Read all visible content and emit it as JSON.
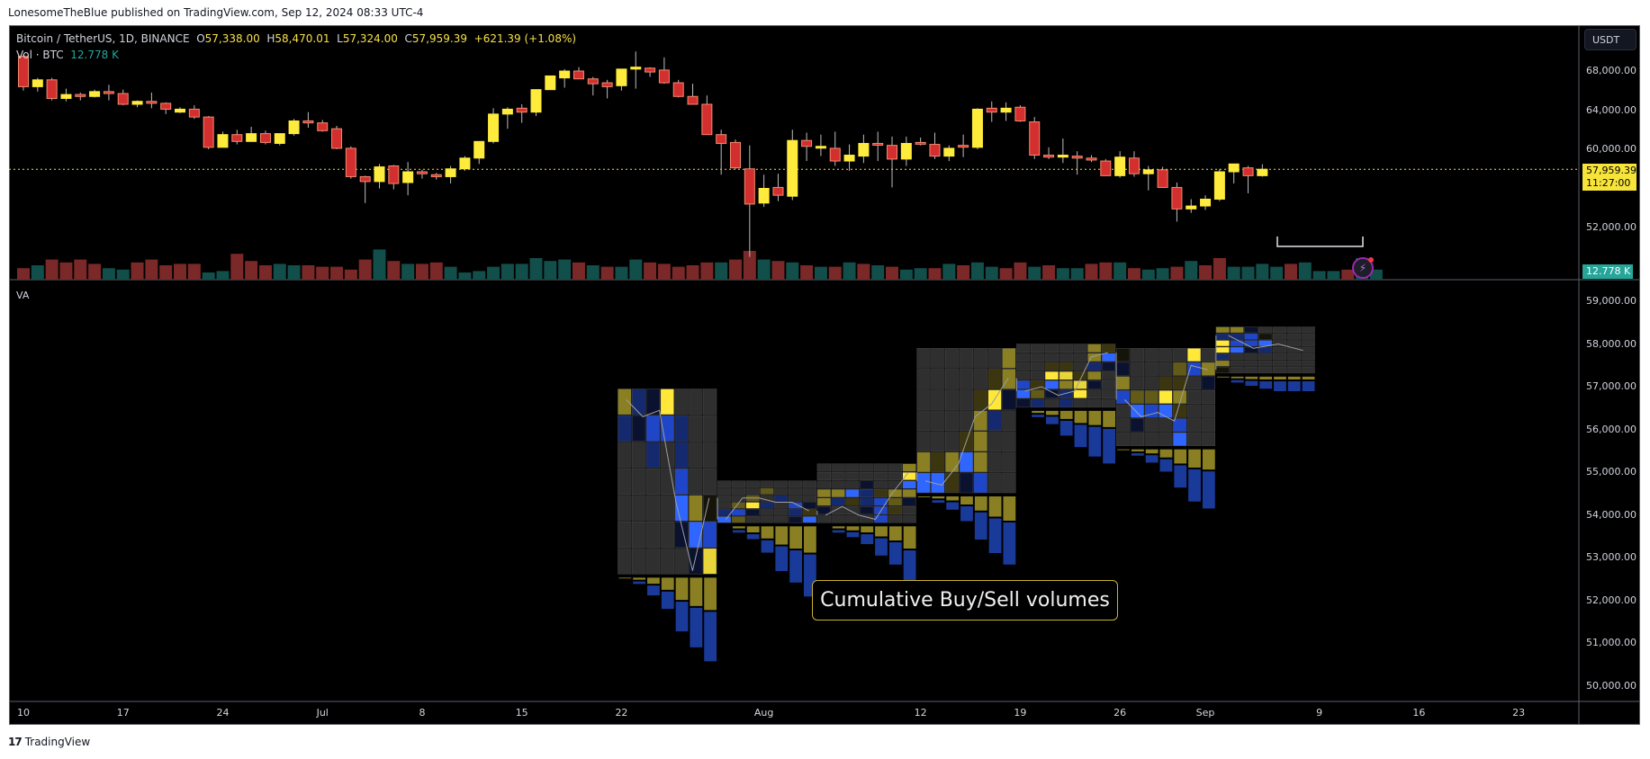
{
  "publisher_line": "LonesomeTheBlue published on TradingView.com, Sep 12, 2024 08:33 UTC-4",
  "legend": {
    "symbol": "Bitcoin / TetherUS, 1D, BINANCE",
    "open_label": "O",
    "open": "57,338.00",
    "high_label": "H",
    "high": "58,470.01",
    "low_label": "L",
    "low": "57,324.00",
    "close_label": "C",
    "close": "57,959.39",
    "change": "+621.39 (+1.08%)",
    "volume_label": "Vol · BTC",
    "volume_value": "12.778 K"
  },
  "pane2_label": "VA",
  "currency_button": "USDT",
  "price_tag": {
    "price": "57,959.39",
    "countdown": "11:27:00"
  },
  "volume_tag": "12.778 K",
  "annotation": "Cumulative Buy/Sell volumes",
  "footer_logo": "TradingView",
  "colors": {
    "up": "#ffeb3b",
    "down": "#d32f2f",
    "vol_up": "#124e4a",
    "vol_down": "#7a2828",
    "buy": "#2962ff",
    "sell": "#c9b22a",
    "last_price": "#f7e43a"
  },
  "chart_data": [
    {
      "type": "candlestick",
      "title": "Bitcoin / TetherUS, 1D, BINANCE",
      "ylabel": "USDT",
      "ylim": [
        48000,
        70500
      ],
      "y_ticks": [
        "68,000.00",
        "64,000.00",
        "60,000.00",
        "52,000.00"
      ],
      "x_ticks": [
        "10",
        "17",
        "24",
        "Jul",
        "8",
        "15",
        "22",
        "Aug",
        "12",
        "19",
        "26",
        "Sep",
        "9",
        "16",
        "23"
      ],
      "x_tick_days": [
        0,
        7,
        14,
        21,
        28,
        35,
        42,
        52,
        63,
        70,
        77,
        83,
        91,
        98,
        105
      ],
      "last_price": 57959.39,
      "candles": [
        [
          69500,
          69700,
          66000,
          66400
        ],
        [
          66400,
          67300,
          65900,
          67100
        ],
        [
          67100,
          67300,
          65000,
          65200
        ],
        [
          65200,
          66200,
          64900,
          65600
        ],
        [
          65600,
          65800,
          65000,
          65400
        ],
        [
          65400,
          66100,
          65300,
          65900
        ],
        [
          65900,
          66600,
          65000,
          65700
        ],
        [
          65700,
          66100,
          64500,
          64600
        ],
        [
          64600,
          65000,
          64300,
          64900
        ],
        [
          64900,
          65800,
          64200,
          64700
        ],
        [
          64700,
          64800,
          63600,
          64100
        ],
        [
          63800,
          64300,
          63700,
          64100
        ],
        [
          64100,
          64500,
          63100,
          63300
        ],
        [
          63300,
          63400,
          60000,
          60200
        ],
        [
          60200,
          61800,
          60200,
          61500
        ],
        [
          61500,
          62000,
          60500,
          60800
        ],
        [
          60800,
          62300,
          60800,
          61600
        ],
        [
          61600,
          61900,
          60500,
          60700
        ],
        [
          60600,
          61300,
          60400,
          61600
        ],
        [
          61600,
          63100,
          61400,
          62900
        ],
        [
          62900,
          63800,
          62200,
          62700
        ],
        [
          62700,
          63000,
          61800,
          61900
        ],
        [
          62100,
          62400,
          60000,
          60100
        ],
        [
          60100,
          60300,
          57000,
          57200
        ],
        [
          57200,
          57300,
          54500,
          56700
        ],
        [
          56700,
          58500,
          56000,
          58200
        ],
        [
          58300,
          58400,
          55900,
          56500
        ],
        [
          56600,
          58700,
          55300,
          57700
        ],
        [
          57700,
          57900,
          57000,
          57500
        ],
        [
          57400,
          57600,
          56900,
          57200
        ],
        [
          57200,
          58300,
          56500,
          58000
        ],
        [
          58000,
          59300,
          57800,
          59100
        ],
        [
          59100,
          60200,
          58500,
          60800
        ],
        [
          60800,
          64200,
          60600,
          63600
        ],
        [
          63600,
          64300,
          62100,
          64100
        ],
        [
          64200,
          64600,
          62700,
          63800
        ],
        [
          63800,
          66100,
          63400,
          66100
        ],
        [
          66100,
          67400,
          66300,
          67500
        ],
        [
          67300,
          68200,
          66300,
          68000
        ],
        [
          68000,
          68400,
          67200,
          67200
        ],
        [
          67200,
          67400,
          65500,
          66700
        ],
        [
          66800,
          67100,
          65200,
          66400
        ],
        [
          66500,
          68200,
          66000,
          68200
        ],
        [
          68200,
          70000,
          66200,
          68400
        ],
        [
          68300,
          68400,
          67400,
          67900
        ],
        [
          68100,
          69400,
          66700,
          66800
        ],
        [
          66800,
          67100,
          65300,
          65400
        ],
        [
          65400,
          66700,
          65000,
          64600
        ],
        [
          64600,
          65500,
          61800,
          61500
        ],
        [
          61500,
          62000,
          57400,
          60600
        ],
        [
          60700,
          61000,
          58000,
          58100
        ],
        [
          58000,
          60400,
          49000,
          54400
        ],
        [
          54500,
          57400,
          54100,
          56000
        ],
        [
          56100,
          57500,
          54700,
          55300
        ],
        [
          55200,
          62000,
          54800,
          60900
        ],
        [
          60900,
          61700,
          58800,
          60300
        ],
        [
          60200,
          61500,
          59300,
          60300
        ],
        [
          60100,
          61800,
          58300,
          58800
        ],
        [
          58800,
          60500,
          57800,
          59400
        ],
        [
          59300,
          61500,
          58600,
          60600
        ],
        [
          60600,
          61800,
          58800,
          60500
        ],
        [
          60400,
          61300,
          56100,
          59000
        ],
        [
          59000,
          61300,
          58300,
          60600
        ],
        [
          60700,
          61200,
          60400,
          60600
        ],
        [
          60500,
          61700,
          59000,
          59300
        ],
        [
          59300,
          60400,
          58800,
          60100
        ],
        [
          60400,
          61500,
          59200,
          60300
        ],
        [
          60200,
          64200,
          60000,
          64100
        ],
        [
          64200,
          64900,
          62800,
          63800
        ],
        [
          63800,
          64800,
          62900,
          64200
        ],
        [
          64300,
          64500,
          62800,
          62900
        ],
        [
          62800,
          63300,
          59000,
          59400
        ],
        [
          59400,
          60200,
          59000,
          59200
        ],
        [
          59200,
          61100,
          58600,
          59400
        ],
        [
          59300,
          59800,
          57400,
          59100
        ],
        [
          59100,
          59400,
          58700,
          58900
        ],
        [
          58800,
          59000,
          57500,
          57300
        ],
        [
          57300,
          59800,
          57100,
          59200
        ],
        [
          59100,
          59800,
          57200,
          57500
        ],
        [
          57500,
          58300,
          55800,
          57900
        ],
        [
          57900,
          58200,
          56300,
          56100
        ],
        [
          56100,
          56600,
          52600,
          53900
        ],
        [
          53900,
          54900,
          53500,
          54200
        ],
        [
          54200,
          55300,
          53800,
          54900
        ],
        [
          54900,
          58000,
          54700,
          57700
        ],
        [
          57700,
          58400,
          56500,
          58500
        ],
        [
          58100,
          58300,
          55500,
          57300
        ],
        [
          57300,
          58470,
          57200,
          57960
        ]
      ],
      "first_candle_day": 0
    },
    {
      "type": "bar",
      "title": "Vol · BTC",
      "last_value": "12.778 K",
      "values": [
        8,
        10,
        14,
        12,
        14,
        11,
        8,
        7,
        12,
        14,
        10,
        11,
        11,
        5,
        6,
        18,
        13,
        10,
        11,
        10,
        10,
        9,
        9,
        7,
        14,
        21,
        13,
        11,
        11,
        12,
        9,
        5,
        6,
        9,
        11,
        11,
        15,
        13,
        14,
        12,
        10,
        9,
        9,
        14,
        12,
        11,
        9,
        10,
        12,
        12,
        14,
        20,
        14,
        13,
        12,
        10,
        9,
        9,
        12,
        11,
        10,
        9,
        7,
        8,
        8,
        11,
        10,
        12,
        9,
        8,
        12,
        9,
        10,
        8,
        8,
        11,
        12,
        12,
        8,
        7,
        8,
        9,
        13,
        10,
        15,
        9,
        9,
        11,
        9,
        11,
        12,
        6,
        6,
        7,
        15,
        7
      ],
      "up": [
        0,
        1,
        0,
        0,
        0,
        0,
        1,
        1,
        0,
        0,
        0,
        0,
        0,
        1,
        1,
        0,
        0,
        0,
        1,
        1,
        0,
        0,
        0,
        0,
        0,
        1,
        0,
        1,
        0,
        0,
        1,
        1,
        1,
        1,
        1,
        1,
        1,
        1,
        1,
        0,
        1,
        0,
        1,
        1,
        0,
        0,
        0,
        0,
        0,
        1,
        0,
        0,
        1,
        0,
        1,
        0,
        1,
        0,
        1,
        0,
        1,
        0,
        1,
        1,
        0,
        1,
        0,
        1,
        1,
        0,
        0,
        1,
        0,
        1,
        1,
        0,
        0,
        1,
        0,
        1,
        1,
        0,
        1,
        0,
        0,
        1,
        1,
        1,
        1,
        0,
        1,
        1,
        1,
        0,
        1,
        1
      ]
    },
    {
      "type": "heatmap",
      "title": "VA",
      "ylabel": "USDT",
      "ylim": [
        49700,
        59400
      ],
      "y_ticks": [
        "59,000.00",
        "58,000.00",
        "57,000.00",
        "56,000.00",
        "55,000.00",
        "54,000.00",
        "53,000.00",
        "52,000.00",
        "51,000.00",
        "50,000.00"
      ],
      "blocks": [
        {
          "start_day": 42,
          "cols": 7,
          "top": 56950,
          "bottom": 52600,
          "rows": 7,
          "cells": [
            "s2b1b0y3e0e0e0",
            "b1b0b2b2b1e0e0",
            "e0e0b1e0b1e0e0",
            "e0e0e0e0b2e0e0",
            "e0e0e0e0b3s2k0",
            "e0e0e0e0b0b3b2",
            "e0e0e0e0e0b0y2"
          ],
          "path": [
            56700,
            56300,
            56450,
            54300,
            52700,
            54400
          ],
          "buy_cum": [
            0,
            0.05,
            0.2,
            0.35,
            0.6,
            0.8,
            1.0
          ],
          "sell_cum": [
            0.02,
            0.05,
            0.15,
            0.3,
            0.55,
            0.7,
            0.8
          ]
        },
        {
          "start_day": 49,
          "cols": 7,
          "top": 54800,
          "bottom": 53800,
          "rows": 6,
          "cells": [
            "e0e0e0e0e0e0e0",
            "e0e0e0s1e0e0e0",
            "e0e0s1e0b1e0e0",
            "e0s1y3b1e0b2b0",
            "b1b2b0e0e0b1s0",
            "b3s1e0e0e0b0b3"
          ],
          "path": [
            53900,
            54400,
            54400,
            54300,
            54300,
            54100
          ],
          "buy_cum": [
            0,
            0.05,
            0.1,
            0.25,
            0.5,
            0.65,
            0.85
          ],
          "sell_cum": [
            0,
            0.05,
            0.15,
            0.3,
            0.45,
            0.55,
            0.65
          ]
        },
        {
          "start_day": 56,
          "cols": 7,
          "top": 55200,
          "bottom": 53800,
          "rows": 7,
          "cells": [
            "e0e0e0e0e0e0s2",
            "e0e0e0e0e0e0y3",
            "e0e0e0b0e0e0b3",
            "s2s2b3b1s0s2s2",
            "s2b1s0b1b2s1b0",
            "b0e0e0b0b2s0e0",
            "e0e0e0e0b2e0e0"
          ],
          "path": [
            54000,
            54200,
            54000,
            53900,
            54500,
            55000
          ],
          "buy_cum": [
            0,
            0.05,
            0.1,
            0.2,
            0.35,
            0.45,
            0.65
          ],
          "sell_cum": [
            0,
            0.05,
            0.1,
            0.15,
            0.25,
            0.35,
            0.55
          ]
        },
        {
          "start_day": 63,
          "cols": 7,
          "top": 57900,
          "bottom": 54500,
          "rows": 7,
          "cells": [
            "e0e0e0e0e0e0s2",
            "e0e0e0e0e0s0s2",
            "e0e0e0e0s0y3b0",
            "e0e0e0e0s2b1e0",
            "e0e0e0s0s2e0e0",
            "s2s0s2b3s2e0e0",
            "b3b3s0b0b2e0e0"
          ],
          "path": [
            54800,
            54700,
            55200,
            56300,
            56600,
            57200
          ],
          "buy_cum": [
            0,
            0.05,
            0.15,
            0.3,
            0.55,
            0.7,
            0.85
          ],
          "sell_cum": [
            0.02,
            0.05,
            0.1,
            0.2,
            0.35,
            0.5,
            0.6
          ]
        },
        {
          "start_day": 70,
          "cols": 7,
          "top": 58000,
          "bottom": 56500,
          "rows": 7,
          "cells": [
            "e0e0e0e0e0s2s0",
            "e0e0e0e0e0s2b3",
            "e0e0s0s0e0b1b0",
            "e0e0y3y2s0s2e0",
            "b2s0b3s2y2b0e0",
            "b3s1b0b1y3e0e0",
            "b0b1e0b1e0e0e0"
          ],
          "path": [
            56900,
            57000,
            56800,
            56900,
            57700,
            57800
          ],
          "buy_cum": [
            0,
            0.05,
            0.15,
            0.3,
            0.45,
            0.6,
            0.7
          ],
          "sell_cum": [
            0,
            0.05,
            0.1,
            0.2,
            0.3,
            0.35,
            0.4
          ]
        },
        {
          "start_day": 77,
          "cols": 7,
          "top": 57900,
          "bottom": 55600,
          "rows": 7,
          "cells": [
            "k0e0e0e0e0y3e0",
            "b0e0e0e0s1b2s2",
            "s2e0e0s0s0e0b0",
            "b2s1s1y3s2e0e0",
            "e0b3b2b3s0e0e0",
            "e0b0e0e0b2e0e0",
            "e0e0e0e0b3e0e0"
          ],
          "path": [
            56700,
            56300,
            56400,
            56200,
            57500,
            57400
          ],
          "buy_cum": [
            0,
            0.05,
            0.15,
            0.25,
            0.45,
            0.65,
            0.75
          ],
          "sell_cum": [
            0.02,
            0.05,
            0.1,
            0.2,
            0.35,
            0.45,
            0.5
          ]
        },
        {
          "start_day": 84,
          "cols": 7,
          "top": 58400,
          "bottom": 57300,
          "rows": 7,
          "cells": [
            "s2s2b0e0e0e0e0",
            "b1b1b2k0e0e0e0",
            "y3b2b2b3e0e0e0",
            "y3b3b0b1e0e0e0",
            "b1e0e0e0e0e0e0",
            "s2e0e0e0e0e0e0",
            "k0e0e0e0e0e0e0"
          ],
          "path": [
            58200,
            57900,
            58000,
            57850
          ],
          "buy_cum": [
            0,
            0.05,
            0.1,
            0.15,
            0.2,
            0.2,
            0.2
          ],
          "sell_cum": [
            0.02,
            0.04,
            0.06,
            0.07,
            0.07,
            0.07,
            0.07
          ]
        }
      ]
    }
  ]
}
